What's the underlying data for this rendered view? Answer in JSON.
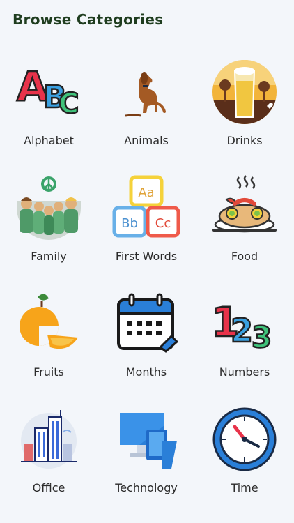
{
  "header": {
    "title": "Browse Categories"
  },
  "categories": [
    {
      "label": "Alphabet",
      "icon": "abc-letters-icon"
    },
    {
      "label": "Animals",
      "icon": "dog-icon"
    },
    {
      "label": "Drinks",
      "icon": "beer-glass-icon"
    },
    {
      "label": "Family",
      "icon": "family-group-icon"
    },
    {
      "label": "First Words",
      "icon": "letter-blocks-icon"
    },
    {
      "label": "Food",
      "icon": "hot-dish-icon"
    },
    {
      "label": "Fruits",
      "icon": "orange-fruit-icon"
    },
    {
      "label": "Months",
      "icon": "calendar-icon"
    },
    {
      "label": "Numbers",
      "icon": "numbers-123-icon"
    },
    {
      "label": "Office",
      "icon": "office-buildings-icon"
    },
    {
      "label": "Technology",
      "icon": "computer-devices-icon"
    },
    {
      "label": "Time",
      "icon": "wall-clock-icon"
    }
  ],
  "icon_text": {
    "abc": [
      "A",
      "B",
      "C"
    ],
    "blocks": [
      "Aa",
      "Bb",
      "Cc"
    ],
    "numbers": [
      "1",
      "2",
      "3"
    ]
  },
  "colors": {
    "background": "#f3f6fa",
    "header": "#1f3d1f",
    "label": "#2b2b2b"
  }
}
